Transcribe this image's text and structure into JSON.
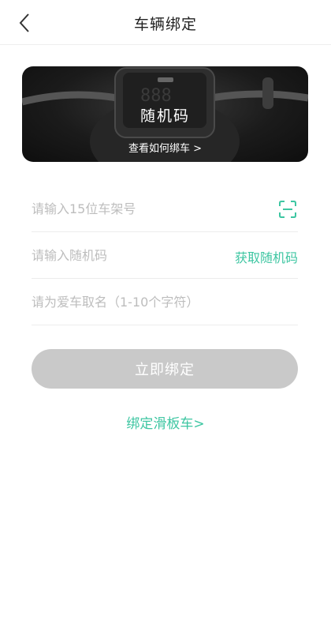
{
  "header": {
    "title": "车辆绑定"
  },
  "banner": {
    "title": "随机码",
    "link": "查看如何绑车 >"
  },
  "form": {
    "frame_placeholder": "请输入15位车架号",
    "code_placeholder": "请输入随机码",
    "get_code_label": "获取随机码",
    "name_placeholder": "请为爱车取名（1-10个字符）"
  },
  "bind_button": "立即绑定",
  "scooter_link": "绑定滑板车>",
  "colors": {
    "accent": "#3ec6a2",
    "button_disabled": "#c9c9c9"
  }
}
